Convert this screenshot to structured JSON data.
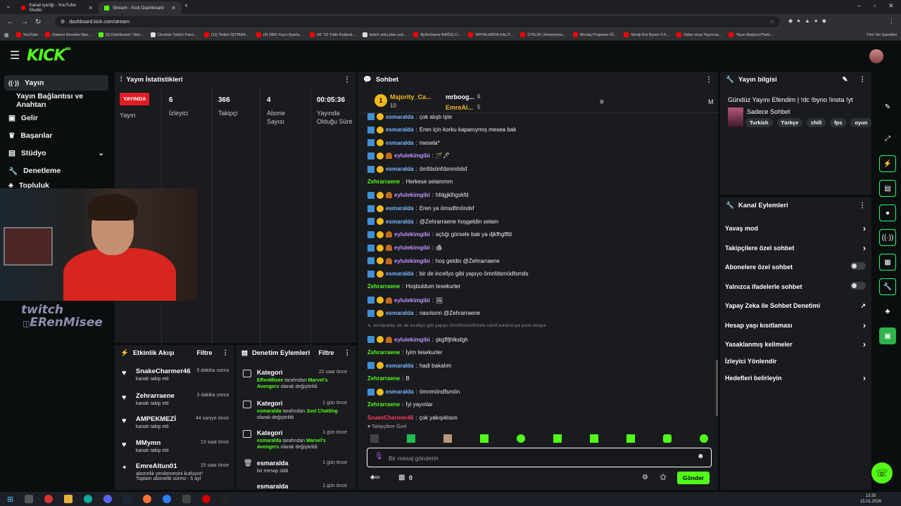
{
  "browser": {
    "tabs": [
      {
        "label": "Kanal içeriği - YouTube Studio",
        "color": "#ff0000"
      },
      {
        "label": "Stream - Kick Dashboard",
        "color": "#53fc18"
      }
    ],
    "url": "dashboard.kick.com/stream",
    "bookmarks": [
      {
        "label": "YouTube",
        "color": "#ff0000"
      },
      {
        "label": "Davinci Resolve Nas...",
        "color": "#ff0000"
      },
      {
        "label": "(3) Dashboard / Stre...",
        "color": "#53fc18"
      },
      {
        "label": "Ücretsiz Twitch Pane...",
        "color": "#dddddd"
      },
      {
        "label": "(11) Twitch İŞTIRAK...",
        "color": "#ff0000"
      },
      {
        "label": "(4) OBS Yayın Ayarla...",
        "color": "#ff0000"
      },
      {
        "label": "(4) \"10 Yılde Kulland...",
        "color": "#ff0000"
      },
      {
        "label": "twitch arka plan wal...",
        "color": "#dddddd"
      },
      {
        "label": "ByNoGame BAĞIŞ Lİ...",
        "color": "#ff0000"
      },
      {
        "label": "YAYINLARDA KALIT...",
        "color": "#ff0000"
      },
      {
        "label": "ÜYELİK | Anonymou...",
        "color": "#ff0000"
      },
      {
        "label": "Montaj Programı Öl...",
        "color": "#ff0000"
      },
      {
        "label": "Sinsiji Koi Ryzen 5 5...",
        "color": "#ff0000"
      },
      {
        "label": "Video veya Yayınına...",
        "color": "#ff0000"
      },
      {
        "label": "Yayın Başlıyor/Twitc...",
        "color": "#ff0000"
      }
    ],
    "all_bookmarks": "Tüm Yer İşaretleri"
  },
  "brand": {
    "logo": "KICK",
    "badge": "BETA",
    "accent": "#53fc18",
    "live_red": "#e01c24"
  },
  "leftnav": {
    "items": [
      {
        "label": "Yayın",
        "icon": "live-icon"
      },
      {
        "label": "Yayın Bağlantısı ve Anahtarı",
        "icon": ""
      },
      {
        "label": "Gelir",
        "icon": "revenue-icon"
      },
      {
        "label": "Başarılar",
        "icon": "trophy-icon"
      },
      {
        "label": "Stüdyo",
        "icon": "studio-icon"
      },
      {
        "label": "Denetleme",
        "icon": "wrench-icon"
      },
      {
        "label": "Topluluk",
        "icon": "community-icon"
      }
    ]
  },
  "stats": {
    "title": "Yayın İstatistikleri",
    "live_badge": "YAYINDA",
    "stream_label": "Yayın",
    "viewers_value": "6",
    "viewers_label": "İzleyici",
    "followers_value": "366",
    "followers_label": "Takipçi",
    "subs_value": "4",
    "subs_label": "Abone Sayısı",
    "duration_value": "00:05:36",
    "duration_label": "Yayında Olduğu Süre"
  },
  "watermark": {
    "line1": "twitch",
    "line2": "ERenMisee"
  },
  "activity": {
    "title": "Etkinlik Akışı",
    "filter": "Filtre",
    "events": [
      {
        "name": "SnakeCharmer46",
        "sub": "kanalı takip etti",
        "time": "5 dakika sonra"
      },
      {
        "name": "Zehrarraene",
        "sub": "kanalı takip etti",
        "time": "3 dakika sonra"
      },
      {
        "name": "AMPEKMEZİ",
        "sub": "kanalı takip etti",
        "time": "44 saniye önce"
      },
      {
        "name": "MMymn",
        "sub": "kanalı takip etti",
        "time": "13 saat önce"
      },
      {
        "name": "EmreAltun01",
        "sub": "abonelik yenilemesini kutluyor!",
        "sub2": "Toplam abonelik süresi - 5 ayl",
        "time": "15 saat önce"
      }
    ]
  },
  "modlog": {
    "title": "Denetim Eylemleri",
    "filter": "Filtre",
    "entries": [
      {
        "title": "Kategori",
        "actor": "ERenMisee",
        "mid": "tarafından",
        "target": "Marvel's Avengers",
        "end": "olarak değiştirildi",
        "time": "22 saat önce"
      },
      {
        "title": "Kategori",
        "actor": "esmaralda",
        "mid": "tarafından",
        "target": "Just Chatting",
        "end": "olarak değiştirildi",
        "time": "1 gün önce"
      },
      {
        "title": "Kategori",
        "actor": "esmaralda",
        "mid": "tarafından",
        "target": "Marvel's Avengers",
        "end": "olarak değiştirildi",
        "time": "1 gün önce"
      },
      {
        "title": "esmaralda",
        "sub": "bir mesajı sildi",
        "time": "1 gün önce"
      },
      {
        "title": "esmaralda",
        "sub": "",
        "time": "1 gün önce"
      }
    ]
  },
  "chat": {
    "title": "Sohbet",
    "leaders": {
      "first_name": "Majority_Ca...",
      "first_score": "10",
      "second_name": "mrboog...",
      "second_score": "6",
      "third_name": "EmreAl...",
      "third_score": "5"
    },
    "messages": [
      {
        "user": "esmaralda",
        "type": "es",
        "badges": 2,
        "text": "çok alıştı işte"
      },
      {
        "user": "esmaralda",
        "type": "es",
        "badges": 2,
        "text": "Eren için korku kapanıymış mesea bak"
      },
      {
        "user": "esmaralda",
        "type": "es",
        "badges": 2,
        "text": "mesela*"
      },
      {
        "user": "eylulekimgibi",
        "type": "ey",
        "badges": 3,
        "text": "🪄🖊"
      },
      {
        "user": "esmaralda",
        "type": "es",
        "badges": 2,
        "text": "ömfdsönfdsnmödsf"
      },
      {
        "user": "Zehrarraene",
        "type": "ze",
        "badges": 0,
        "text": "Herkese selammm"
      },
      {
        "user": "eylulekimgibi",
        "type": "ey",
        "badges": 3,
        "text": "hfdgjklhgskfd"
      },
      {
        "user": "esmaralda",
        "type": "es",
        "badges": 2,
        "text": "Eren ya ömsdfmöndsf"
      },
      {
        "user": "esmaralda",
        "type": "es",
        "badges": 2,
        "text": "@Zehrarraene hoşgeldin selam"
      },
      {
        "user": "eylulekimgibi",
        "type": "ey",
        "badges": 3,
        "text": "açtığı görsele bak ya djkfhgflfd"
      },
      {
        "user": "eylulekimgibi",
        "type": "ey",
        "badges": 3,
        "text": "🪨"
      },
      {
        "user": "eylulekimgibi",
        "type": "ey",
        "badges": 3,
        "text": "hoş geldin @Zehrarraene"
      },
      {
        "user": "esmaralda",
        "type": "es",
        "badges": 2,
        "text": "bir de incellyo gibi yapıyo ömnfdsmödfsmds"
      },
      {
        "user": "Zehrarraene",
        "type": "ze",
        "badges": 0,
        "text": "Hoşbuldum tesekurler"
      },
      {
        "user": "eylulekimgibi",
        "type": "ey",
        "badges": 3,
        "text": "🖼"
      },
      {
        "user": "esmaralda",
        "type": "es",
        "badges": 2,
        "text": "nasılsınn @Zehrarraene"
      },
      {
        "user": "",
        "type": "reply",
        "badges": 0,
        "text": "esmaralda: bir de incellyo gibi yapıyo ömnfdsmödfsmds isimli kullanıcıya yanıt veriyor"
      },
      {
        "user": "eylulekimgibi",
        "type": "ey",
        "badges": 3,
        "text": "şkgflfjhlksfgh"
      },
      {
        "user": "Zehrarraene",
        "type": "ze",
        "badges": 0,
        "text": "İyim tesekurler"
      },
      {
        "user": "esmaralda",
        "type": "es",
        "badges": 2,
        "text": "hadi bakalım"
      },
      {
        "user": "Zehrarraene",
        "type": "ze",
        "badges": 0,
        "text": "B"
      },
      {
        "user": "esmaralda",
        "type": "es",
        "badges": 2,
        "text": "ömnmöndfsmön"
      },
      {
        "user": "Zehrarraene",
        "type": "ze",
        "badges": 0,
        "text": "İyi yayınlar"
      },
      {
        "user": "SnakeCharmer46",
        "type": "sn",
        "badges": 0,
        "text": "çok yakışıklısın"
      }
    ],
    "followers_only": "Takipçilere Özel",
    "placeholder": "Bir mesaj gönderin",
    "count": "0",
    "send": "Gönder"
  },
  "streaminfo": {
    "title": "Yayın bilgisi",
    "stream_title": "Gündüz Yayını Efendim | !dc !byno !insta !yt",
    "category": "Sadece Sohbet",
    "tags": [
      "Turkish",
      "Türkçe",
      "chill",
      "fps",
      "oyun"
    ]
  },
  "channel_actions": {
    "title": "Kanal Eylemleri",
    "items": [
      {
        "label": "Yavaş mod",
        "kind": "chevron"
      },
      {
        "label": "Takipçilere özel sohbet",
        "kind": "chevron"
      },
      {
        "label": "Abonelere özel sohbet",
        "kind": "toggle"
      },
      {
        "label": "Yalnızca ifadelerle sohbet",
        "kind": "toggle"
      },
      {
        "label": "Yapay Zeka ile Sohbet Denetimi",
        "kind": "external"
      },
      {
        "label": "Hesap yaşı kısıtlaması",
        "kind": "chevron"
      },
      {
        "label": "Yasaklanmış kelimeler",
        "kind": "chevron"
      },
      {
        "label": "İzleyici Yönlendir",
        "kind": "none"
      },
      {
        "label": "Hedefleri belirleyin",
        "kind": "chevron"
      }
    ]
  },
  "taskbar": {
    "time": "13:35",
    "date": "15.01.2026"
  }
}
